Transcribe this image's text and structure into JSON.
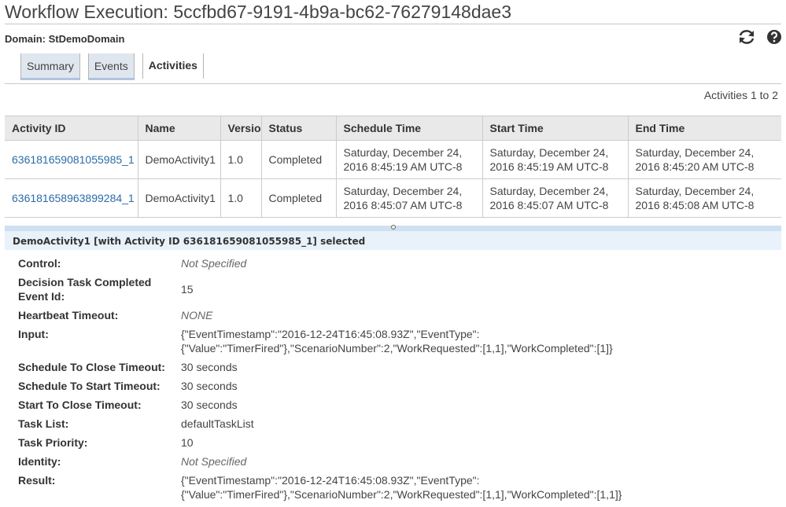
{
  "title": "Workflow Execution: 5ccfbd67-9191-4b9a-bc62-76279148dae3",
  "domain": {
    "label": "Domain:",
    "value": "StDemoDomain"
  },
  "icons": {
    "refresh": "refresh-icon",
    "help": "help-icon"
  },
  "tabs": [
    {
      "label": "Summary",
      "active": false
    },
    {
      "label": "Events",
      "active": false
    },
    {
      "label": "Activities",
      "active": true
    }
  ],
  "paging": "Activities 1 to 2",
  "table": {
    "columns": [
      "Activity ID",
      "Name",
      "Version",
      "Status",
      "Schedule Time",
      "Start Time",
      "End Time"
    ],
    "rows": [
      {
        "activity_id": "636181659081055985_1",
        "name": "DemoActivity1",
        "version": "1.0",
        "status": "Completed",
        "schedule_time": "Saturday, December 24, 2016 8:45:19 AM UTC-8",
        "start_time": "Saturday, December 24, 2016 8:45:19 AM UTC-8",
        "end_time": "Saturday, December 24, 2016 8:45:20 AM UTC-8"
      },
      {
        "activity_id": "636181658963899284_1",
        "name": "DemoActivity1",
        "version": "1.0",
        "status": "Completed",
        "schedule_time": "Saturday, December 24, 2016 8:45:07 AM UTC-8",
        "start_time": "Saturday, December 24, 2016 8:45:07 AM UTC-8",
        "end_time": "Saturday, December 24, 2016 8:45:08 AM UTC-8"
      }
    ]
  },
  "selection_header": "DemoActivity1 [with Activity ID 636181659081055985_1] selected",
  "details": {
    "control": {
      "label": "Control:",
      "value": "Not Specified"
    },
    "decision_task": {
      "label_1": "Decision Task Completed",
      "label_2": "Event Id:",
      "value": "15"
    },
    "heartbeat_timeout": {
      "label": "Heartbeat Timeout:",
      "value": "NONE"
    },
    "input": {
      "label": "Input:",
      "line_1": "{\"EventTimestamp\":\"2016-12-24T16:45:08.93Z\",\"EventType\":",
      "line_2": "{\"Value\":\"TimerFired\"},\"ScenarioNumber\":2,\"WorkRequested\":[1,1],\"WorkCompleted\":[1]}"
    },
    "schedule_to_close": {
      "label": "Schedule To Close Timeout:",
      "value": "30 seconds"
    },
    "schedule_to_start": {
      "label": "Schedule To Start Timeout:",
      "value": "30 seconds"
    },
    "start_to_close": {
      "label": "Start To Close Timeout:",
      "value": "30 seconds"
    },
    "task_list": {
      "label": "Task List:",
      "value": "defaultTaskList"
    },
    "task_priority": {
      "label": "Task Priority:",
      "value": "10"
    },
    "identity": {
      "label": "Identity:",
      "value": "Not Specified"
    },
    "result": {
      "label": "Result:",
      "line_1": "{\"EventTimestamp\":\"2016-12-24T16:45:08.93Z\",\"EventType\":",
      "line_2": "{\"Value\":\"TimerFired\"},\"ScenarioNumber\":2,\"WorkRequested\":[1,1],\"WorkCompleted\":[1,1]}"
    }
  }
}
